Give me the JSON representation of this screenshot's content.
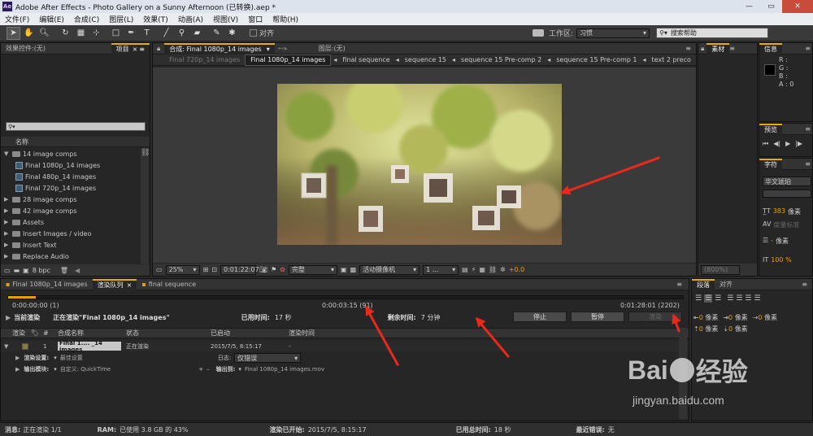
{
  "window": {
    "title": "Adobe After Effects - Photo Gallery on a Sunny Afternoon (已转换).aep *",
    "logo": "Ae"
  },
  "menu": [
    "文件(F)",
    "编辑(E)",
    "合成(C)",
    "图层(L)",
    "效果(T)",
    "动画(A)",
    "视图(V)",
    "窗口",
    "帮助(H)"
  ],
  "toolbar": {
    "snap_label": "对齐",
    "workspace_label": "工作区:",
    "workspace_value": "习惯",
    "search_placeholder": "搜索帮助"
  },
  "project": {
    "tabs": [
      "效果控件:(无)",
      "项目"
    ],
    "name_header": "名称",
    "items": [
      {
        "label": "14 image comps",
        "type": "folder",
        "open": true,
        "indent": 0
      },
      {
        "label": "Final 1080p_14 images",
        "type": "comp",
        "indent": 1
      },
      {
        "label": "Final 480p_14 images",
        "type": "comp",
        "indent": 1
      },
      {
        "label": "Final 720p_14 images",
        "type": "comp",
        "indent": 1
      },
      {
        "label": "28 image comps",
        "type": "folder",
        "open": false,
        "indent": 0
      },
      {
        "label": "42 image comps",
        "type": "folder",
        "open": false,
        "indent": 0
      },
      {
        "label": "Assets",
        "type": "folder",
        "open": false,
        "indent": 0
      },
      {
        "label": "Insert Images / video",
        "type": "folder",
        "open": false,
        "indent": 0
      },
      {
        "label": "Insert Text",
        "type": "folder",
        "open": false,
        "indent": 0
      },
      {
        "label": "Replace Audio",
        "type": "folder",
        "open": false,
        "indent": 0
      },
      {
        "label": "Solids",
        "type": "folder",
        "open": false,
        "indent": 0
      }
    ],
    "bpc": "8 bpc"
  },
  "composition": {
    "panel_title": "合成: Final 1080p_14 images",
    "layer_title": "图层:(无)",
    "tabs": [
      "Final 720p_14 images",
      "Final 1080p_14 images",
      "final sequence",
      "sequence 15",
      "sequence 15 Pre-comp 2",
      "sequence 15 Pre-comp 1",
      "text 2 preco"
    ],
    "active_tab": "Final 1080p_14 images",
    "zoom": "25%",
    "timecode": "0:01:22:07",
    "resolution": "完整",
    "camera": "活动摄像机",
    "views": "1 ...",
    "exposure": "+0.0"
  },
  "right": {
    "info_title": "信息",
    "info_channels": [
      "R :",
      "G :",
      "B :",
      "A : 0"
    ],
    "material_title": "素材",
    "preview_title": "预览",
    "char_title": "字符",
    "font_name": "华文琥珀",
    "font_size": "383",
    "px": "像素",
    "tracking_label": "度量标准",
    "scale": "100 %",
    "leading_zoom": "(800%)",
    "para_tab": "段落",
    "align_tab": "对齐",
    "indent_values": [
      "0 像素",
      "0 像素",
      "0 像素",
      "0 像素",
      "0 像素"
    ]
  },
  "bottom": {
    "tabs": [
      "Final 1080p_14 images",
      "渲染队列",
      "final sequence"
    ],
    "progress_start": "0:00:00:00 (1)",
    "progress_mid": "0:00:03:15 (91)",
    "progress_end": "0:01:28:01 (2202)",
    "progress": 0.041,
    "current_render_label": "当前渲染",
    "rendering_text": "正在渲染\"Final 1080p_14 images\"",
    "elapsed_label": "已用时间:",
    "elapsed_value": "17 秒",
    "remaining_label": "剩余时间:",
    "remaining_value": "7 分钟",
    "stop_btn": "停止",
    "pause_btn": "暂停",
    "render_btn": "渲染",
    "columns": [
      "渲染",
      "#",
      "合成名称",
      "状态",
      "已启动",
      "渲染时间"
    ],
    "job": {
      "num": "1",
      "name": "Final 1.... _14 images",
      "status": "正在渲染",
      "started": "2015/7/5, 8:15:17",
      "rtime": "-"
    },
    "render_settings_label": "渲染设置:",
    "render_settings_value": "最佳设置",
    "log_label": "日志:",
    "log_value": "仅错误",
    "output_module_label": "输出模块:",
    "output_module_value": "自定义: QuickTime",
    "output_to_label": "输出到:",
    "output_to_value": "Final 1080p_14 images.mov"
  },
  "status": {
    "message_label": "消息:",
    "message_value": "正在渲染 1/1",
    "ram_label": "RAM:",
    "ram_value": "已使用 3.8 GB 的 43%",
    "started_label": "渲染已开始:",
    "started_value": "2015/7/5, 8:15:17",
    "total_label": "已用总时间:",
    "total_value": "18 秒",
    "error_label": "最近错误:",
    "error_value": "无"
  },
  "watermark": {
    "brand": "Bai",
    "brand2": "经验",
    "url": "jingyan.baidu.com"
  },
  "colors": {
    "accent": "#e8a000",
    "arrow": "#e8291c",
    "panel": "#262626"
  }
}
